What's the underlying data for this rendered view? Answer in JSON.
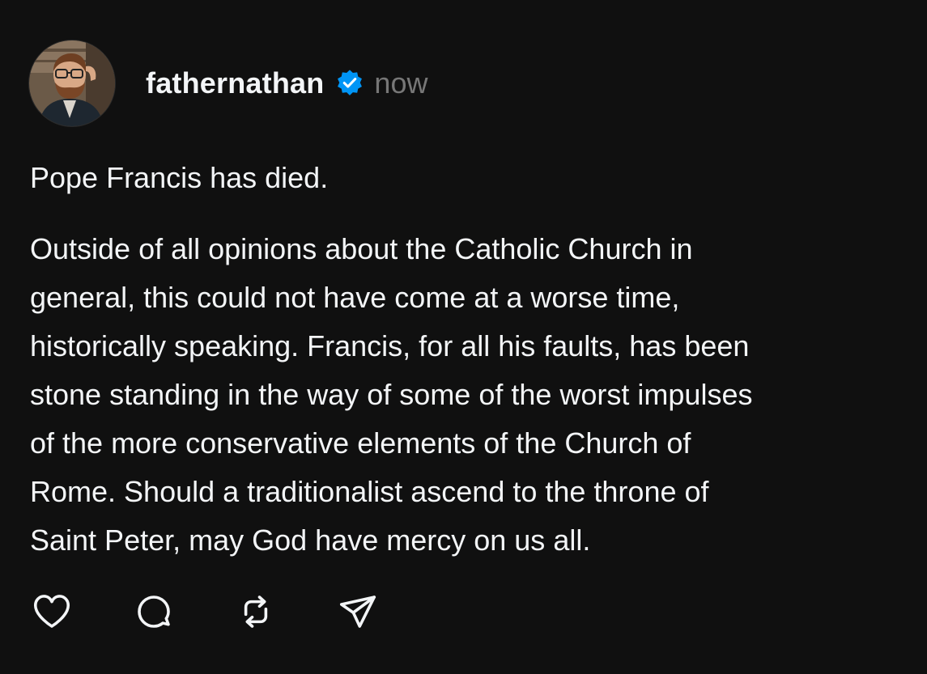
{
  "post": {
    "author": {
      "username": "fathernathan",
      "verified": true,
      "avatar_icon": "profile-photo"
    },
    "timestamp": "now",
    "paragraphs": [
      "Pope Francis has died.",
      "Outside of all opinions about the Catholic Church in\ngeneral, this could not have come at a worse time,\nhistorically speaking. Francis, for all his faults, has been\nstone standing in the way of some of the worst impulses\nof the more conservative elements of the Church of\nRome. Should a traditionalist ascend to the throne of\nSaint Peter, may God have mercy on us all."
    ],
    "actions": [
      {
        "icon": "heart-icon"
      },
      {
        "icon": "comment-icon"
      },
      {
        "icon": "repost-icon"
      },
      {
        "icon": "share-icon"
      }
    ]
  },
  "colors": {
    "background": "#101010",
    "text": "#f3f5f7",
    "muted": "#777777",
    "verified": "#0095f6"
  }
}
